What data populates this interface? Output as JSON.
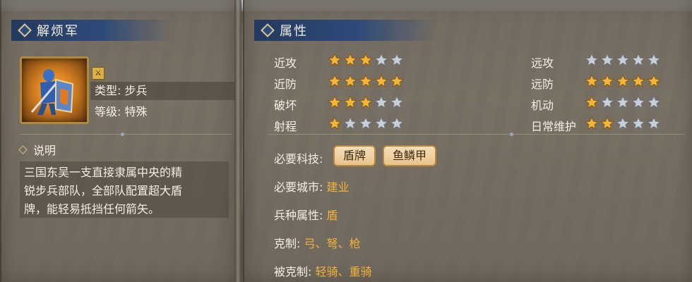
{
  "unit": {
    "name": "解烦军",
    "type_label": "类型: 步兵",
    "grade_label": "等级: 特殊"
  },
  "description": {
    "heading": "说明",
    "lines": [
      "三国东吴一支直接隶属中央的精",
      "锐步兵部队，全部队配置超大盾",
      "牌，能轻易抵挡任何箭矢。"
    ]
  },
  "attributes": {
    "heading": "属性",
    "left": [
      {
        "label": "近攻",
        "stars": 3
      },
      {
        "label": "近防",
        "stars": 5
      },
      {
        "label": "破坏",
        "stars": 3
      },
      {
        "label": "射程",
        "stars": 1
      }
    ],
    "right": [
      {
        "label": "远攻",
        "stars": 0
      },
      {
        "label": "远防",
        "stars": 5
      },
      {
        "label": "机动",
        "stars": 1
      },
      {
        "label": "日常维护",
        "stars": 2
      }
    ],
    "max_stars": 5
  },
  "requirements": {
    "tech_label": "必要科技:",
    "tech_items": [
      "盾牌",
      "鱼鳞甲"
    ],
    "city_label": "必要城市:",
    "city_value": "建业",
    "class_label": "兵种属性:",
    "class_value": "盾",
    "counters_label": "克制:",
    "counters_value": "弓、弩、枪",
    "countered_label": "被克制:",
    "countered_value": "轻骑、重骑"
  },
  "colors": {
    "star_filled": "#f2b63a",
    "star_empty": "#c9cfd9",
    "accent_value": "#f1b23a",
    "ribbon": "#2d4a78"
  }
}
